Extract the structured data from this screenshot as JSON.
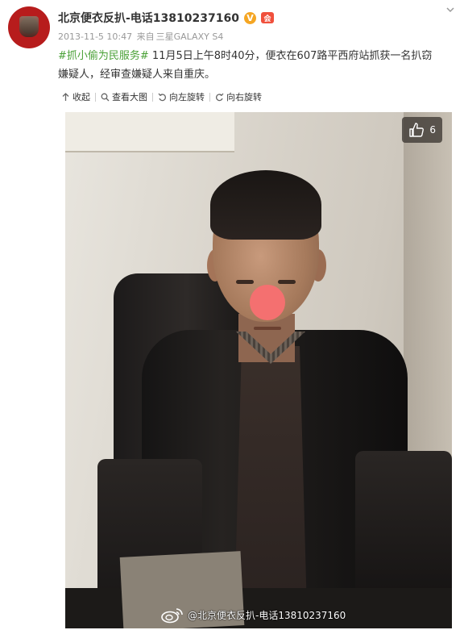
{
  "post": {
    "username": "北京便衣反扒-电话13810237160",
    "verified_badge": "V",
    "member_badge": "会",
    "timestamp": "2013-11-5 10:47",
    "source_prefix": "来自",
    "source_device": "三星GALAXY S4",
    "topic": "#抓小偷为民服务#",
    "text_line1": " 11月5日上午8时40分，便衣在607路平西府站抓获一名扒窃",
    "text_line2": "嫌疑人，经审查嫌疑人来自重庆。"
  },
  "toolbar": {
    "collapse_label": "收起",
    "view_large_label": "查看大图",
    "rotate_left_label": "向左旋转",
    "rotate_right_label": "向右旋转"
  },
  "photo": {
    "like_count": "6",
    "watermark": "@北京便衣反扒-电话13810237160"
  },
  "colors": {
    "topic": "#4aa137",
    "verified": "#f5a623",
    "redaction": "#f47070"
  },
  "icons": [
    "avatar",
    "verified-icon",
    "member-icon",
    "chevron-down-icon",
    "collapse-icon",
    "search-icon",
    "rotate-left-icon",
    "rotate-right-icon",
    "thumbs-up-icon",
    "weibo-logo-icon"
  ]
}
